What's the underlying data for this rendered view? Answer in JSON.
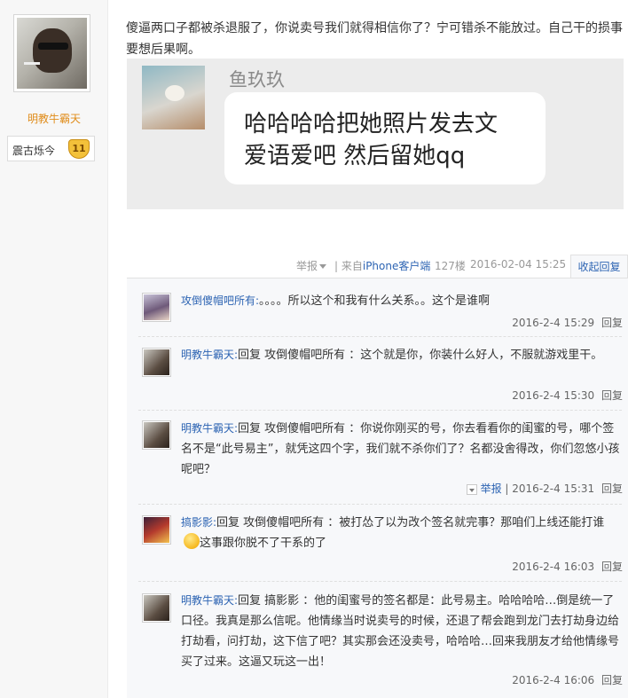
{
  "author": {
    "name": "明教牛霸天",
    "level_title": "震古烁今",
    "level_number": "11"
  },
  "post": {
    "text": "傻逼两口子都被杀退服了，你说卖号我们就得相信你了？宁可错杀不能放过。自己干的损事要想后果啊。",
    "screenshot": {
      "sender_name": "鱼玖玖",
      "message_line1": "哈哈哈哈把她照片发去文",
      "message_line2": "爱语爱吧 然后留她qq"
    },
    "meta": {
      "report": "举报",
      "client_prefix": "| 来自",
      "client_name": "iPhone客户端",
      "floor": "127楼",
      "datetime": "2016-02-04 15:25",
      "collapse": "收起回复"
    }
  },
  "replies": [
    {
      "user": "攻倒傻帽吧所有:",
      "content": "。。。。所以这个和我有什么关系。。这个是谁啊",
      "datetime": "2016-2-4 15:29",
      "reply_label": "回复",
      "report": ""
    },
    {
      "user": "明教牛霸天:",
      "content": "回复 攻倒傻帽吧所有 ：这个就是你，你装什么好人，不服就游戏里干。",
      "datetime": "2016-2-4 15:30",
      "reply_label": "回复",
      "report": ""
    },
    {
      "user": "明教牛霸天:",
      "content": "回复 攻倒傻帽吧所有 ：你说你刚买的号，你去看看你的闺蜜的号，哪个签名不是“此号易主”，就凭这四个字，我们就不杀你们了？名都没舍得改，你们忽悠小孩呢吧？",
      "datetime": "2016-2-4 15:31",
      "reply_label": "回复",
      "report": "举报"
    },
    {
      "user": "搞影影:",
      "content_before_emoji": "回复 攻倒傻帽吧所有 ：被打怂了以为改个签名就完事？那咱们上线还能打谁",
      "content_after_emoji": "这事跟你脱不了干系的了",
      "emoji": "smile-emoji",
      "datetime": "2016-2-4 16:03",
      "reply_label": "回复",
      "report": ""
    },
    {
      "user": "明教牛霸天:",
      "content": "回复 搞影影 ：他的闺蜜号的签名都是：此号易主。哈哈哈哈…倒是统一了口径。我真是那么信呢。他情缘当时说卖号的时候，还退了帮会跑到龙门去打劫身边给打劫看，问打劫，这下信了吧？其实那会还没卖号，哈哈哈…回来我朋友才给他情缘号买了过来。这逼又玩这一出！",
      "datetime": "2016-2-4 16:06",
      "reply_label": "回复",
      "report": ""
    }
  ],
  "colors": {
    "link": "#2d64b3",
    "author_name": "#e08c1a",
    "meta_gray": "#999999"
  }
}
